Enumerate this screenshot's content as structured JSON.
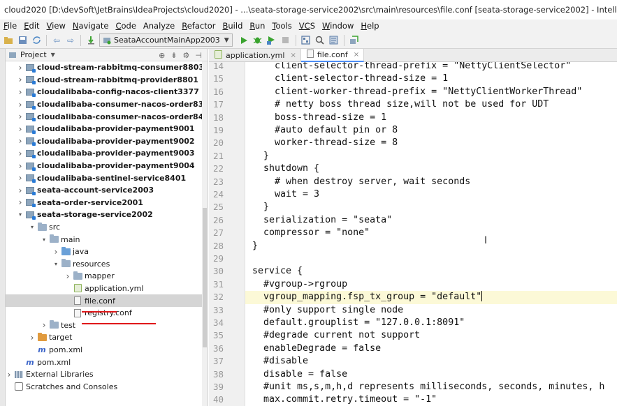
{
  "window": {
    "title": "cloud2020 [D:\\devSoft\\JetBrains\\IdeaProjects\\cloud2020] - ...\\seata-storage-service2002\\src\\main\\resources\\file.conf [seata-storage-service2002] - IntelliJ IDEA"
  },
  "menu": [
    {
      "mn": "F",
      "rest": "ile"
    },
    {
      "mn": "E",
      "rest": "dit"
    },
    {
      "mn": "V",
      "rest": "iew"
    },
    {
      "mn": "N",
      "rest": "avigate"
    },
    {
      "mn": "C",
      "rest": "ode"
    },
    {
      "mn": "",
      "rest": "Analyze",
      "full": "Analyze"
    },
    {
      "mn": "R",
      "rest": "efactor"
    },
    {
      "mn": "B",
      "rest": "uild"
    },
    {
      "mn": "R",
      "rest": "un",
      "key": "u"
    },
    {
      "mn": "T",
      "rest": "ools"
    },
    {
      "mn": "VC",
      "rest": "S"
    },
    {
      "mn": "W",
      "rest": "indow"
    },
    {
      "mn": "H",
      "rest": "elp"
    }
  ],
  "toolbar": {
    "run_config": "SeataAccountMainApp2003"
  },
  "project": {
    "header": "Project",
    "tree": [
      {
        "label": "cloud-stream-rabbitmq-consumer8803",
        "indent": 0,
        "arrow": "›",
        "icon": "mod",
        "bold": true
      },
      {
        "label": "cloud-stream-rabbitmq-provider8801",
        "indent": 0,
        "arrow": "›",
        "icon": "mod",
        "bold": true
      },
      {
        "label": "cloudalibaba-config-nacos-client3377",
        "indent": 0,
        "arrow": "›",
        "icon": "mod",
        "bold": true
      },
      {
        "label": "cloudalibaba-consumer-nacos-order83",
        "indent": 0,
        "arrow": "›",
        "icon": "mod",
        "bold": true
      },
      {
        "label": "cloudalibaba-consumer-nacos-order84",
        "indent": 0,
        "arrow": "›",
        "icon": "mod",
        "bold": true
      },
      {
        "label": "cloudalibaba-provider-payment9001",
        "indent": 0,
        "arrow": "›",
        "icon": "mod",
        "bold": true
      },
      {
        "label": "cloudalibaba-provider-payment9002",
        "indent": 0,
        "arrow": "›",
        "icon": "mod",
        "bold": true
      },
      {
        "label": "cloudalibaba-provider-payment9003",
        "indent": 0,
        "arrow": "›",
        "icon": "mod",
        "bold": true
      },
      {
        "label": "cloudalibaba-provider-payment9004",
        "indent": 0,
        "arrow": "›",
        "icon": "mod",
        "bold": true
      },
      {
        "label": "cloudalibaba-sentinel-service8401",
        "indent": 0,
        "arrow": "›",
        "icon": "mod",
        "bold": true
      },
      {
        "label": "seata-account-service2003",
        "indent": 0,
        "arrow": "›",
        "icon": "mod",
        "bold": true
      },
      {
        "label": "seata-order-service2001",
        "indent": 0,
        "arrow": "›",
        "icon": "mod",
        "bold": true
      },
      {
        "label": "seata-storage-service2002",
        "indent": 0,
        "arrow": "⌄",
        "icon": "mod",
        "bold": true
      },
      {
        "label": "src",
        "indent": 1,
        "arrow": "⌄",
        "icon": "folder",
        "bold": false
      },
      {
        "label": "main",
        "indent": 2,
        "arrow": "⌄",
        "icon": "folder",
        "bold": false
      },
      {
        "label": "java",
        "indent": 3,
        "arrow": "›",
        "icon": "folder-blue",
        "bold": false
      },
      {
        "label": "resources",
        "indent": 3,
        "arrow": "⌄",
        "icon": "folder",
        "bold": false
      },
      {
        "label": "mapper",
        "indent": 4,
        "arrow": "›",
        "icon": "folder",
        "bold": false
      },
      {
        "label": "application.yml",
        "indent": 4,
        "arrow": "",
        "icon": "yml",
        "bold": false
      },
      {
        "label": "file.conf",
        "indent": 4,
        "arrow": "",
        "icon": "conf",
        "bold": false,
        "selected": true
      },
      {
        "label": "registry.conf",
        "indent": 4,
        "arrow": "",
        "icon": "conf",
        "bold": false
      },
      {
        "label": "test",
        "indent": 2,
        "arrow": "›",
        "icon": "folder",
        "bold": false
      },
      {
        "label": "target",
        "indent": 1,
        "arrow": "›",
        "icon": "folder-orange",
        "bold": false
      },
      {
        "label": "pom.xml",
        "indent": 1,
        "arrow": "",
        "icon": "maven",
        "bold": false
      },
      {
        "label": "pom.xml",
        "indent": 0,
        "arrow": "",
        "icon": "maven",
        "bold": false
      },
      {
        "label": "External Libraries",
        "indent": -1,
        "arrow": "›",
        "icon": "lib",
        "bold": false
      },
      {
        "label": "Scratches and Consoles",
        "indent": -1,
        "arrow": "",
        "icon": "scratch",
        "bold": false
      }
    ]
  },
  "editor": {
    "tabs": [
      {
        "label": "application.yml",
        "icon": "yml",
        "active": false
      },
      {
        "label": "file.conf",
        "icon": "conf",
        "active": true
      }
    ],
    "lines": [
      {
        "n": "14",
        "text": "    client-selector-thread-prefix = \"NettyClientSelector\""
      },
      {
        "n": "15",
        "text": "    client-selector-thread-size = 1"
      },
      {
        "n": "16",
        "text": "    client-worker-thread-prefix = \"NettyClientWorkerThread\""
      },
      {
        "n": "17",
        "text": "    # netty boss thread size,will not be used for UDT"
      },
      {
        "n": "18",
        "text": "    boss-thread-size = 1"
      },
      {
        "n": "19",
        "text": "    #auto default pin or 8"
      },
      {
        "n": "20",
        "text": "    worker-thread-size = 8"
      },
      {
        "n": "21",
        "text": "  }"
      },
      {
        "n": "22",
        "text": "  shutdown {"
      },
      {
        "n": "23",
        "text": "    # when destroy server, wait seconds"
      },
      {
        "n": "24",
        "text": "    wait = 3"
      },
      {
        "n": "25",
        "text": "  }"
      },
      {
        "n": "26",
        "text": "  serialization = \"seata\""
      },
      {
        "n": "27",
        "text": "  compressor = \"none\""
      },
      {
        "n": "28",
        "text": "}"
      },
      {
        "n": "29",
        "text": ""
      },
      {
        "n": "30",
        "text": "service {"
      },
      {
        "n": "31",
        "text": "  #vgroup->rgroup"
      },
      {
        "n": "32",
        "text": "  vgroup_mapping.fsp_tx_group = \"default\"",
        "current": true
      },
      {
        "n": "33",
        "text": "  #only support single node"
      },
      {
        "n": "34",
        "text": "  default.grouplist = \"127.0.0.1:8091\""
      },
      {
        "n": "35",
        "text": "  #degrade current not support"
      },
      {
        "n": "36",
        "text": "  enableDegrade = false"
      },
      {
        "n": "37",
        "text": "  #disable"
      },
      {
        "n": "38",
        "text": "  disable = false"
      },
      {
        "n": "39",
        "text": "  #unit ms,s,m,h,d represents milliseconds, seconds, minutes, h"
      },
      {
        "n": "40",
        "text": "  max.commit.retry.timeout = \"-1\""
      }
    ]
  },
  "colors": {
    "selection": "#d5d5d5",
    "current_line": "#fcf9d7",
    "annotation_red": "#e0181a",
    "run_green": "#3aa32f"
  }
}
